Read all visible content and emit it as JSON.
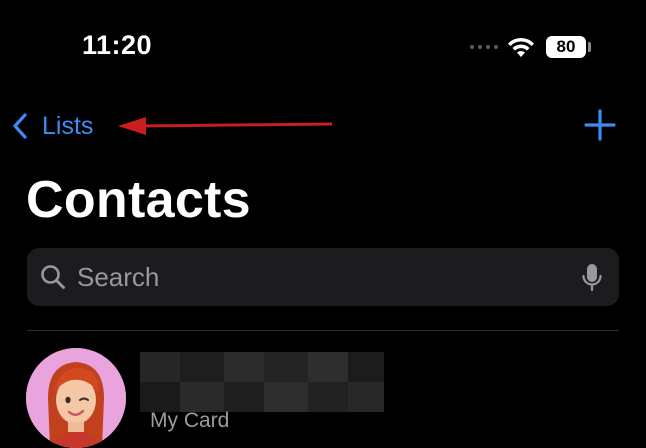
{
  "status_bar": {
    "time": "11:20",
    "battery_level": "80",
    "signal_icon": "signal-dots-icon",
    "wifi_icon": "wifi-icon"
  },
  "nav": {
    "back_label": "Lists",
    "back_icon": "chevron-left-icon",
    "add_icon": "plus-icon"
  },
  "annotation": {
    "arrow_color": "#c81e1e"
  },
  "page": {
    "title": "Contacts"
  },
  "search": {
    "placeholder": "Search",
    "value": ""
  },
  "my_card": {
    "name": "",
    "subtitle": "My Card"
  },
  "colors": {
    "background": "#000000",
    "accent": "#3d8cf5",
    "search_bg": "#1c1c1e",
    "secondary_text": "#9b9ba0"
  }
}
